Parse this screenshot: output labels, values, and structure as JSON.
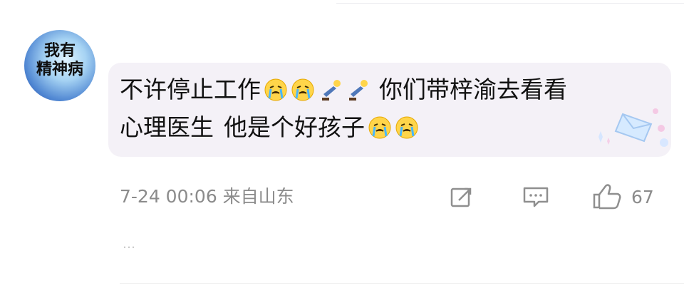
{
  "comment": {
    "avatar_text": "我有\n精神病",
    "line1_part1": "不许停止工作",
    "line1_part2": "你们带梓渝去看看",
    "line2_part1": "心理医生",
    "line2_part2": "他是个好孩子",
    "emoji_names": [
      "crying-emoji",
      "crying-emoji",
      "kneeling-emoji",
      "kneeling-emoji",
      "crying-emoji",
      "crying-emoji"
    ],
    "meta": "7-24 00:06 来自山东",
    "like_count": "67",
    "more": "…"
  },
  "colors": {
    "bubble_bg": "#f4f1f7",
    "text_primary": "#111111",
    "text_secondary": "#8b8b8b",
    "icon": "#8f8f8f"
  },
  "icons": [
    "repost-icon",
    "reply-icon",
    "like-icon"
  ]
}
